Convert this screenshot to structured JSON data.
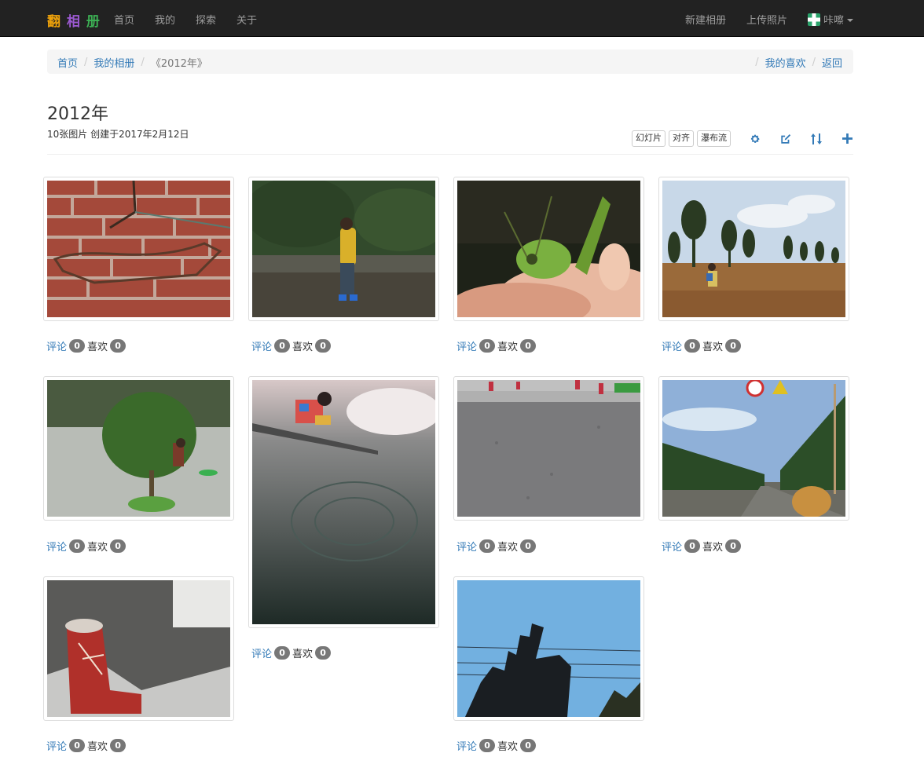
{
  "navbar": {
    "brand_chars": [
      {
        "ch": "翻",
        "color": "#f0a30a"
      },
      {
        "ch": "相",
        "color": "#9b59d0"
      },
      {
        "ch": "册",
        "color": "#3cb054"
      }
    ],
    "left_links": [
      "首页",
      "我的",
      "探索",
      "关于"
    ],
    "new_album": "新建相册",
    "upload": "上传照片",
    "username": "咔嚓"
  },
  "breadcrumb": {
    "home": "首页",
    "my_albums": "我的相册",
    "current": "《2012年》",
    "favorites": "我的喜欢",
    "back": "返回",
    "separator": "/"
  },
  "album": {
    "title": "2012年",
    "meta": "10张图片 创建于2017年2月12日"
  },
  "toolbar": {
    "slideshow": "幻灯片",
    "align": "对齐",
    "waterfall": "瀑布流",
    "icon_color": "#337ab7",
    "icons": [
      "gear-icon",
      "edit-icon",
      "sort-icon",
      "plus-icon"
    ]
  },
  "photos": [
    {
      "subject": "brick-wall",
      "comment_label": "评论",
      "comments": "0",
      "like_label": "喜欢",
      "likes": "0"
    },
    {
      "subject": "child-yellow-shirt",
      "comment_label": "评论",
      "comments": "0",
      "like_label": "喜欢",
      "likes": "0"
    },
    {
      "subject": "grasshopper",
      "comment_label": "评论",
      "comments": "0",
      "like_label": "喜欢",
      "likes": "0"
    },
    {
      "subject": "child-field",
      "comment_label": "评论",
      "comments": "0",
      "like_label": "喜欢",
      "likes": "0"
    },
    {
      "subject": "tree-rain",
      "comment_label": "评论",
      "comments": "0",
      "like_label": "喜欢",
      "likes": "0"
    },
    {
      "subject": "child-water",
      "comment_label": "评论",
      "comments": "0",
      "like_label": "喜欢",
      "likes": "0"
    },
    {
      "subject": "road-asphalt",
      "comment_label": "评论",
      "comments": "0",
      "like_label": "喜欢",
      "likes": "0"
    },
    {
      "subject": "highway-trees",
      "comment_label": "评论",
      "comments": "0",
      "like_label": "喜欢",
      "likes": "0"
    },
    {
      "subject": "red-boot",
      "comment_label": "评论",
      "comments": "0",
      "like_label": "喜欢",
      "likes": "0"
    },
    {
      "subject": "hand-sky",
      "comment_label": "评论",
      "comments": "0",
      "like_label": "喜欢",
      "likes": "0"
    }
  ]
}
